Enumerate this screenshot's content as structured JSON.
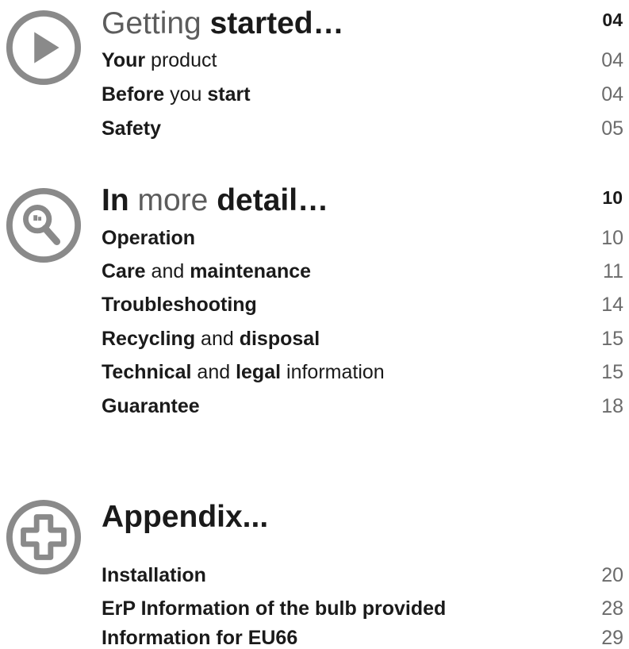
{
  "sections": [
    {
      "icon": "play-icon",
      "heading": [
        {
          "t": "Getting ",
          "w": "light"
        },
        {
          "t": "started…",
          "w": "bold"
        }
      ],
      "page": "04",
      "entries": [
        {
          "parts": [
            {
              "t": "Your",
              "w": "bold"
            },
            {
              "t": " product",
              "w": "light"
            }
          ],
          "page": "04"
        },
        {
          "parts": [
            {
              "t": "Before",
              "w": "bold"
            },
            {
              "t": " you ",
              "w": "light"
            },
            {
              "t": "start",
              "w": "bold"
            }
          ],
          "page": "04"
        },
        {
          "parts": [
            {
              "t": "Safety",
              "w": "bold"
            }
          ],
          "page": "05"
        }
      ]
    },
    {
      "icon": "magnifier-icon",
      "heading": [
        {
          "t": "In",
          "w": "bold"
        },
        {
          "t": " more ",
          "w": "light"
        },
        {
          "t": "detail…",
          "w": "bold"
        }
      ],
      "page": "10",
      "entries": [
        {
          "parts": [
            {
              "t": "Operation",
              "w": "bold"
            }
          ],
          "page": "10"
        },
        {
          "parts": [
            {
              "t": "Care",
              "w": "bold"
            },
            {
              "t": " and ",
              "w": "light"
            },
            {
              "t": "maintenance",
              "w": "bold"
            }
          ],
          "page": "11"
        },
        {
          "parts": [
            {
              "t": "Troubleshooting",
              "w": "bold"
            }
          ],
          "page": "14"
        },
        {
          "parts": [
            {
              "t": "Recycling",
              "w": "bold"
            },
            {
              "t": " and ",
              "w": "light"
            },
            {
              "t": "disposal",
              "w": "bold"
            }
          ],
          "page": "15"
        },
        {
          "parts": [
            {
              "t": "Technical",
              "w": "bold"
            },
            {
              "t": " and ",
              "w": "light"
            },
            {
              "t": "legal",
              "w": "bold"
            },
            {
              "t": " information",
              "w": "light"
            }
          ],
          "page": "15"
        },
        {
          "parts": [
            {
              "t": "Guarantee",
              "w": "bold"
            }
          ],
          "page": "18"
        }
      ]
    },
    {
      "icon": "plus-icon",
      "heading": [
        {
          "t": "Appendix...",
          "w": "bold"
        }
      ],
      "page": "",
      "entries": [
        {
          "parts": [
            {
              "t": "Installation",
              "w": "bold"
            }
          ],
          "page": "20"
        },
        {
          "parts": [
            {
              "t": "ErP Information of the bulb provided",
              "w": "bold"
            }
          ],
          "page": "28"
        },
        {
          "parts": [
            {
              "t": "Information for EU66",
              "w": "bold"
            }
          ],
          "page": "29"
        }
      ]
    }
  ],
  "colors": {
    "icon": "#8a8a8a",
    "text": "#1a1a1a",
    "light_heading": "#5c5c5c",
    "page_number": "#6b6b6b"
  }
}
